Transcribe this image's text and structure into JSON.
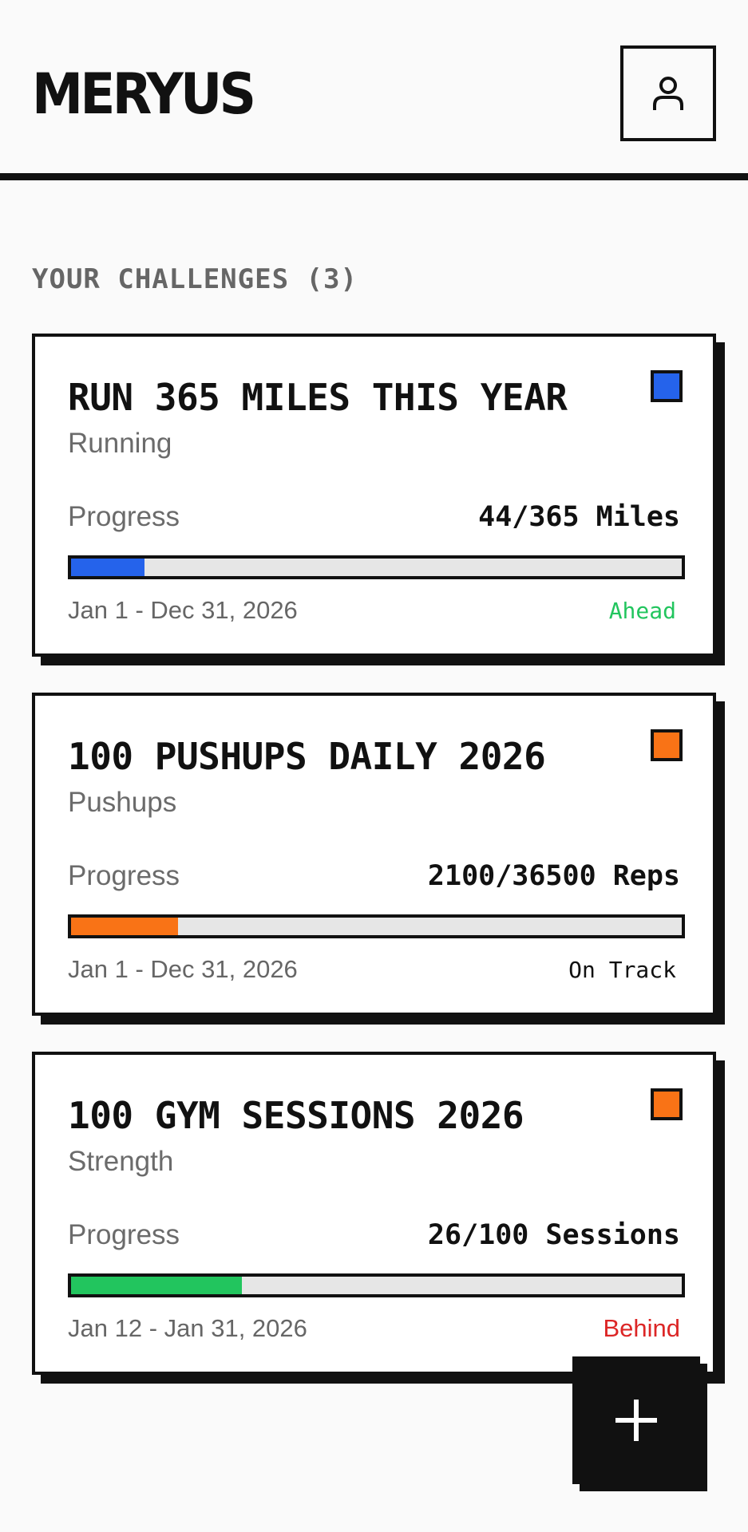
{
  "header": {
    "logo": "MERYUS",
    "profile_icon": "user-icon"
  },
  "section": {
    "title": "YOUR CHALLENGES (3)"
  },
  "challenges": [
    {
      "title": "RUN 365 MILES THIS YEAR",
      "category": "Running",
      "progress_label": "Progress",
      "progress_value": "44/365 Miles",
      "progress_fraction": 0.1205,
      "dates": "Jan 1 - Dec 31, 2026",
      "status": "Ahead",
      "color": "#2563eb",
      "status_color": "#22c55e"
    },
    {
      "title": "100 PUSHUPS DAILY 2026",
      "category": "Pushups",
      "progress_label": "Progress",
      "progress_value": "2100/36500 Reps",
      "progress_fraction": 0.175,
      "dates": "Jan 1 - Dec 31, 2026",
      "status": "On Track",
      "color": "#f97316",
      "status_color": "#111111"
    },
    {
      "title": "100 GYM SESSIONS 2026",
      "category": "Strength",
      "progress_label": "Progress",
      "progress_value": "26/100 Sessions",
      "progress_fraction": 0.28,
      "dates": "Jan 12 - Jan 31, 2026",
      "status": "Behind",
      "color": "#f97316",
      "progress_color": "#22c55e",
      "status_color": "#dc2626"
    }
  ],
  "fab": {
    "icon": "plus-icon"
  }
}
